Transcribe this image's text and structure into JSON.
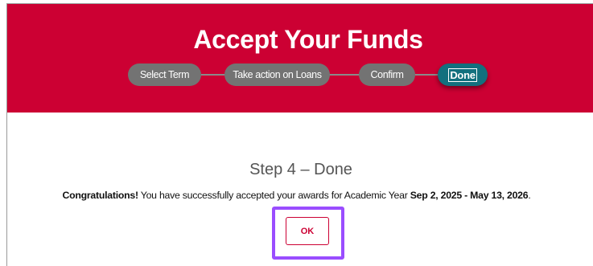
{
  "banner": {
    "title": "Accept Your Funds",
    "background_color": "#cc0033"
  },
  "stepper": {
    "steps": [
      {
        "label": "Select Term",
        "state": "completed"
      },
      {
        "label": "Take action on Loans",
        "state": "completed"
      },
      {
        "label": "Confirm",
        "state": "completed"
      },
      {
        "label": "Done",
        "state": "active"
      }
    ],
    "inactive_color": "#737373",
    "active_color": "#12707e"
  },
  "content": {
    "step_heading": "Step 4 – Done",
    "message": {
      "lead_bold": "Congratulations!",
      "text": " You have successfully accepted your awards for Academic Year ",
      "date_range_bold": "Sep 2, 2025 - May 13, 2026",
      "trailing": "."
    },
    "ok_button_label": "OK",
    "ok_highlight_color": "#9a4dff"
  }
}
